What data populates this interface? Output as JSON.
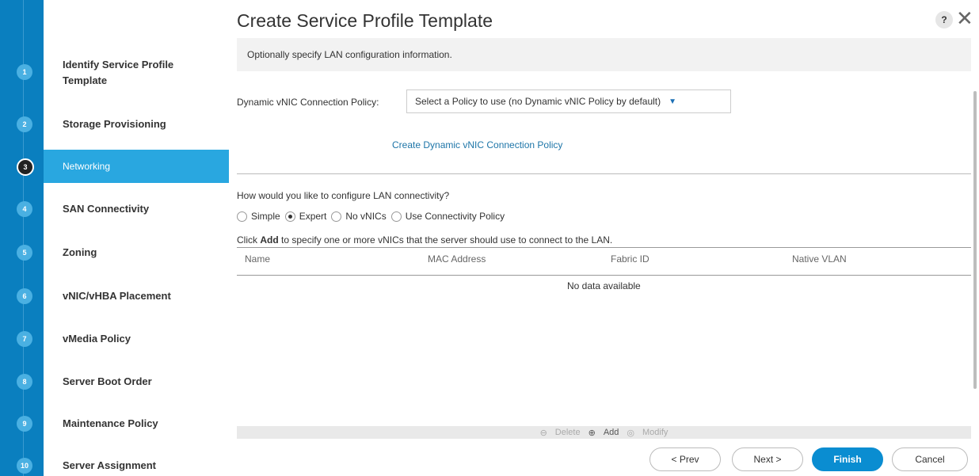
{
  "wizard": {
    "steps": [
      {
        "num": "1",
        "label": "Identify Service Profile Template"
      },
      {
        "num": "2",
        "label": "Storage Provisioning"
      },
      {
        "num": "3",
        "label": "Networking"
      },
      {
        "num": "4",
        "label": "SAN Connectivity"
      },
      {
        "num": "5",
        "label": "Zoning"
      },
      {
        "num": "6",
        "label": "vNIC/vHBA Placement"
      },
      {
        "num": "7",
        "label": "vMedia Policy"
      },
      {
        "num": "8",
        "label": "Server Boot Order"
      },
      {
        "num": "9",
        "label": "Maintenance Policy"
      },
      {
        "num": "10",
        "label": "Server Assignment"
      }
    ],
    "active_step": "Networking",
    "accent_color": "#29a7e0",
    "rail_color": "#0a7fbf"
  },
  "header": {
    "title": "Create Service Profile Template",
    "help_glyph": "?",
    "close_glyph": "✕"
  },
  "info": {
    "text": "Optionally specify LAN configuration information."
  },
  "dynamic_vnic": {
    "label": "Dynamic vNIC Connection Policy:",
    "selected": "Select a Policy to use (no Dynamic vNIC Policy by default)",
    "create_link": "Create Dynamic vNIC Connection Policy"
  },
  "lan": {
    "question": "How would you like to configure LAN connectivity?",
    "options": [
      "Simple",
      "Expert",
      "No vNICs",
      "Use Connectivity Policy"
    ],
    "selected_option": "Expert",
    "instruction_prefix": "Click ",
    "instruction_bold": "Add",
    "instruction_suffix": " to specify one or more vNICs that the server should use to connect to the LAN."
  },
  "table": {
    "columns": [
      "Name",
      "MAC Address",
      "Fabric ID",
      "Native VLAN"
    ],
    "empty_text": "No data available",
    "actions": {
      "delete": "Delete",
      "add": "Add",
      "modify": "Modify"
    }
  },
  "footer": {
    "prev": "< Prev",
    "next": "Next >",
    "finish": "Finish",
    "cancel": "Cancel"
  }
}
